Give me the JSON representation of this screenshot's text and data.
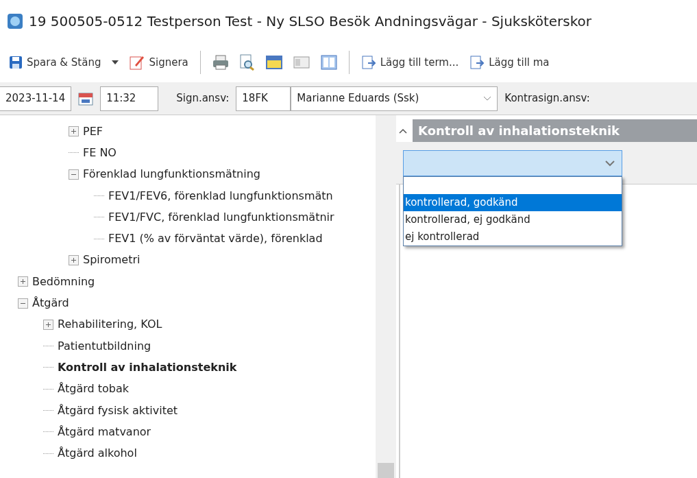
{
  "window": {
    "title": "19 500505-0512 Testperson Test - Ny SLSO Besök Andningsvägar - Sjuksköterskor"
  },
  "toolbar": {
    "save_close": "Spara & Stäng",
    "sign": "Signera",
    "add_term": "Lägg till term...",
    "add_more": "Lägg till ma"
  },
  "fields": {
    "date": "2023-11-14",
    "time": "11:32",
    "sign_label": "Sign.ansv:",
    "sign_code": "18FK",
    "sign_name": "Marianne Eduards (Ssk)",
    "countersign_label": "Kontrasign.ansv:"
  },
  "tree": [
    {
      "children": [
        {
          "children": [
            {
              "label": "PEF",
              "expanded": false,
              "selected": false
            },
            {
              "label": "FE NO",
              "selected": false
            },
            {
              "label": "Förenklad lungfunktionsmätning",
              "expanded": true,
              "selected": false,
              "children": [
                {
                  "label": "FEV1/FEV6, förenklad lungfunktionsmätn",
                  "selected": false
                },
                {
                  "label": "FEV1/FVC, förenklad lungfunktionsmätnir",
                  "selected": false
                },
                {
                  "label": "FEV1 (% av förväntat värde), förenklad",
                  "selected": false
                }
              ]
            },
            {
              "label": "Spirometri",
              "expanded": false,
              "selected": false
            }
          ]
        }
      ]
    },
    {
      "label": "Bedömning",
      "expanded": false,
      "selected": false
    },
    {
      "label": "Åtgärd",
      "expanded": true,
      "selected": false,
      "children": [
        {
          "label": "Rehabilitering, KOL",
          "expanded": false,
          "selected": false
        },
        {
          "label": "Patientutbildning",
          "selected": false
        },
        {
          "label": "Kontroll av inhalationsteknik",
          "selected": true
        },
        {
          "label": "Åtgärd tobak",
          "selected": false
        },
        {
          "label": "Åtgärd fysisk aktivitet",
          "selected": false
        },
        {
          "label": "Åtgärd matvanor",
          "selected": false
        },
        {
          "label": "Åtgärd alkohol",
          "selected": false
        }
      ]
    }
  ],
  "panel": {
    "title": "Kontroll av inhalationsteknik",
    "expanded": true,
    "dropdown": {
      "open": true,
      "options": [
        {
          "label": "kontrollerad, godkänd",
          "selected": true
        },
        {
          "label": "kontrollerad, ej godkänd",
          "selected": false
        },
        {
          "label": "ej kontrollerad",
          "selected": false
        }
      ]
    }
  }
}
